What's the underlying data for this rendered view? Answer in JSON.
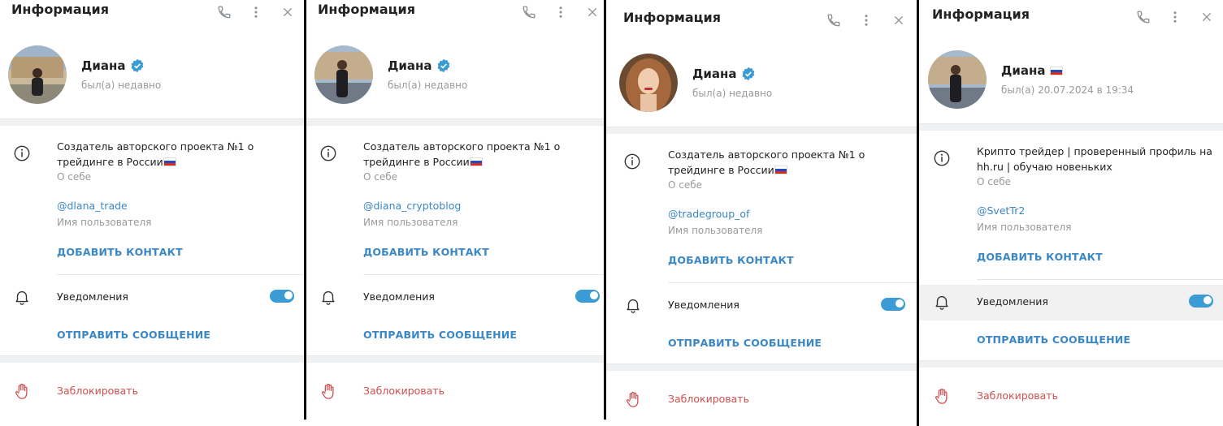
{
  "panels": [
    {
      "title": "Информация",
      "name": "Диана",
      "status": "был(а) недавно",
      "verified": true,
      "bio_line1": "Создатель авторского проекта №1 о",
      "bio_line2": "трейдинге в России",
      "bio_caption": "О себе",
      "username": "@dlana_trade",
      "username_caption": "Имя пользователя",
      "add_contact": "ДОБАВИТЬ КОНТАКТ",
      "notifications": "Уведомления",
      "notifications_on": true,
      "send_message": "ОТПРАВИТЬ СООБЩЕНИЕ",
      "block": "Заблокировать"
    },
    {
      "title": "Информация",
      "name": "Диана",
      "status": "был(а) недавно",
      "verified": true,
      "bio_line1": "Создатель авторского проекта №1 о",
      "bio_line2": "трейдинге в России",
      "bio_caption": "О себе",
      "username": "@diana_cryptoblog",
      "username_caption": "Имя пользователя",
      "add_contact": "ДОБАВИТЬ КОНТАКТ",
      "notifications": "Уведомления",
      "notifications_on": true,
      "send_message": "ОТПРАВИТЬ СООБЩЕНИЕ",
      "block": "Заблокировать"
    },
    {
      "title": "Информация",
      "name": "Диана",
      "status": "был(а) недавно",
      "verified": true,
      "bio_line1": "Создатель авторского проекта №1 о",
      "bio_line2": "трейдинге в России",
      "bio_caption": "О себе",
      "username": "@tradegroup_of",
      "username_caption": "Имя пользователя",
      "add_contact": "ДОБАВИТЬ КОНТАКТ",
      "notifications": "Уведомления",
      "notifications_on": true,
      "send_message": "ОТПРАВИТЬ СООБЩЕНИЕ",
      "block": "Заблокировать"
    },
    {
      "title": "Информация",
      "name": "Диана",
      "status": "был(а) 20.07.2024 в 19:34",
      "verified": false,
      "bio_line1": "Крипто трейдер | проверенный профиль на",
      "bio_line2": "hh.ru | обучаю новеньких",
      "bio_caption": "О себе",
      "username": "@SvetTr2",
      "username_caption": "Имя пользователя",
      "add_contact": "ДОБАВИТЬ КОНТАКТ",
      "notifications": "Уведомления",
      "notifications_on": true,
      "send_message": "ОТПРАВИТЬ СООБЩЕНИЕ",
      "block": "Заблокировать"
    }
  ],
  "icons": {
    "phone": "phone-icon",
    "more": "more-vertical-icon",
    "close": "close-icon",
    "info": "info-icon",
    "bell": "bell-icon",
    "block": "hand-icon",
    "verified": "verified-badge-icon",
    "flag": "russia-flag-icon"
  },
  "colors": {
    "accent": "#3a87c8",
    "toggle": "#3a9bd5",
    "danger": "#cf4f4f",
    "muted": "#9a9a9a"
  }
}
